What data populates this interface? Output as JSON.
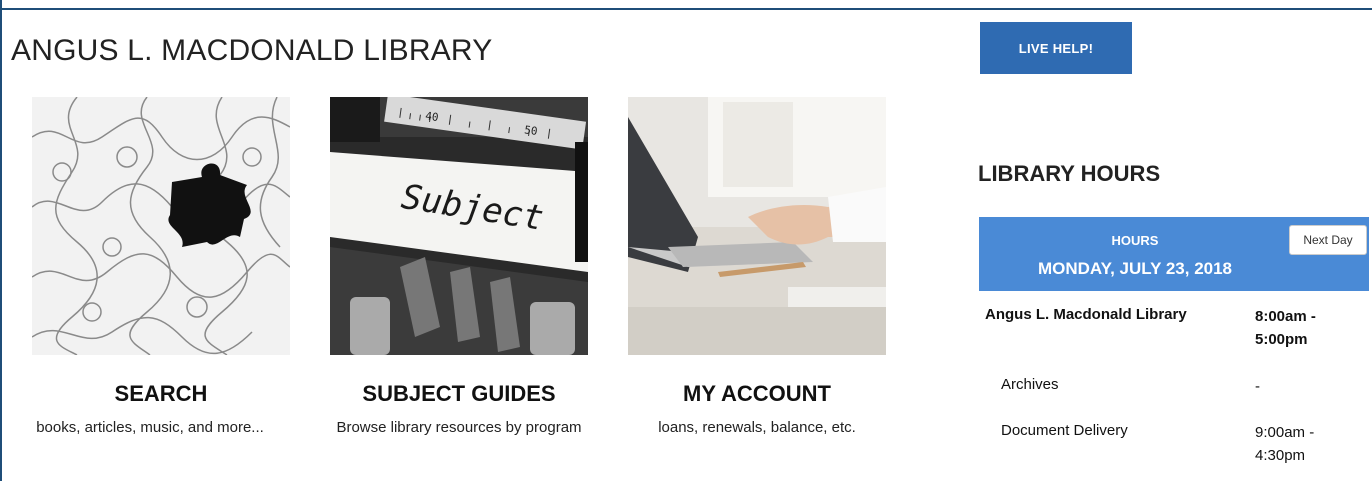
{
  "page_title": "ANGUS L. MACDONALD LIBRARY",
  "tiles": [
    {
      "title": "SEARCH",
      "desc": "books, articles, music, and more..."
    },
    {
      "title": "SUBJECT GUIDES",
      "desc": "Browse library resources by program"
    },
    {
      "title": "MY ACCOUNT",
      "desc": "loans, renewals, balance, etc."
    }
  ],
  "images": {
    "subject_word": "Subject",
    "ruler_numbers": [
      "40",
      "50"
    ]
  },
  "live_help": "LIVE HELP!",
  "hours": {
    "heading": "LIBRARY HOURS",
    "label": "HOURS",
    "date": "MONDAY, JULY 23, 2018",
    "next_day": "Next Day",
    "rows": [
      {
        "location": "Angus L. Macdonald Library",
        "time_line1": "8:00am -",
        "time_line2": "5:00pm"
      },
      {
        "location": "Archives",
        "time_line1": "-",
        "time_line2": ""
      },
      {
        "location": "Document Delivery",
        "time_line1": "9:00am -",
        "time_line2": "4:30pm"
      }
    ]
  },
  "colors": {
    "accent": "#2f6bb2",
    "hours_header": "#4a8ad6",
    "frame": "#1f4e79"
  }
}
